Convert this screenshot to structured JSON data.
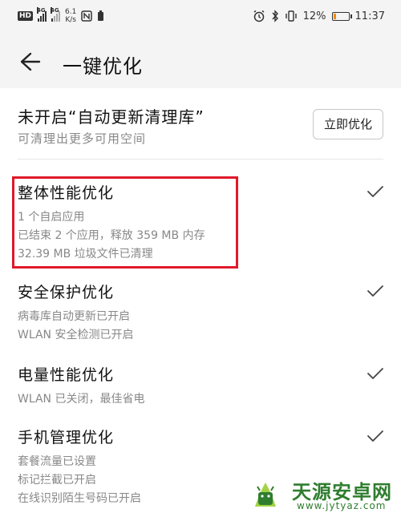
{
  "status_bar": {
    "hd": "HD",
    "net1": "4G",
    "net2": "4G",
    "speed_value": "6.1",
    "speed_unit": "K/s",
    "battery_percent": "12%",
    "battery_level": 0.12,
    "time": "11:37",
    "battery_color": "#f08a00"
  },
  "toolbar": {
    "title": "一键优化",
    "back_icon": "arrow-left-icon"
  },
  "banner": {
    "title": "未开启“自动更新清理库”",
    "subtitle": "可清理出更多可用空间",
    "button_label": "立即优化"
  },
  "sections": [
    {
      "title": "整体性能优化",
      "lines": [
        "1 个自启应用",
        "已结束 2 个应用，释放 359 MB 内存",
        "32.39 MB 垃圾文件已清理"
      ],
      "done": true
    },
    {
      "title": "安全保护优化",
      "lines": [
        "病毒库自动更新已开启",
        "WLAN 安全检测已开启"
      ],
      "done": true
    },
    {
      "title": "电量性能优化",
      "lines": [
        "WLAN 已关闭，最佳省电"
      ],
      "done": true
    },
    {
      "title": "手机管理优化",
      "lines": [
        "套餐流量已设置",
        "标记拦截已开启",
        "在线识别陌生号码已开启"
      ],
      "done": true
    }
  ],
  "highlight_color": "#e0192a",
  "watermark": {
    "name": "天源安卓网",
    "url": "www.jytyaz.com",
    "color": "#2f7d2f"
  }
}
